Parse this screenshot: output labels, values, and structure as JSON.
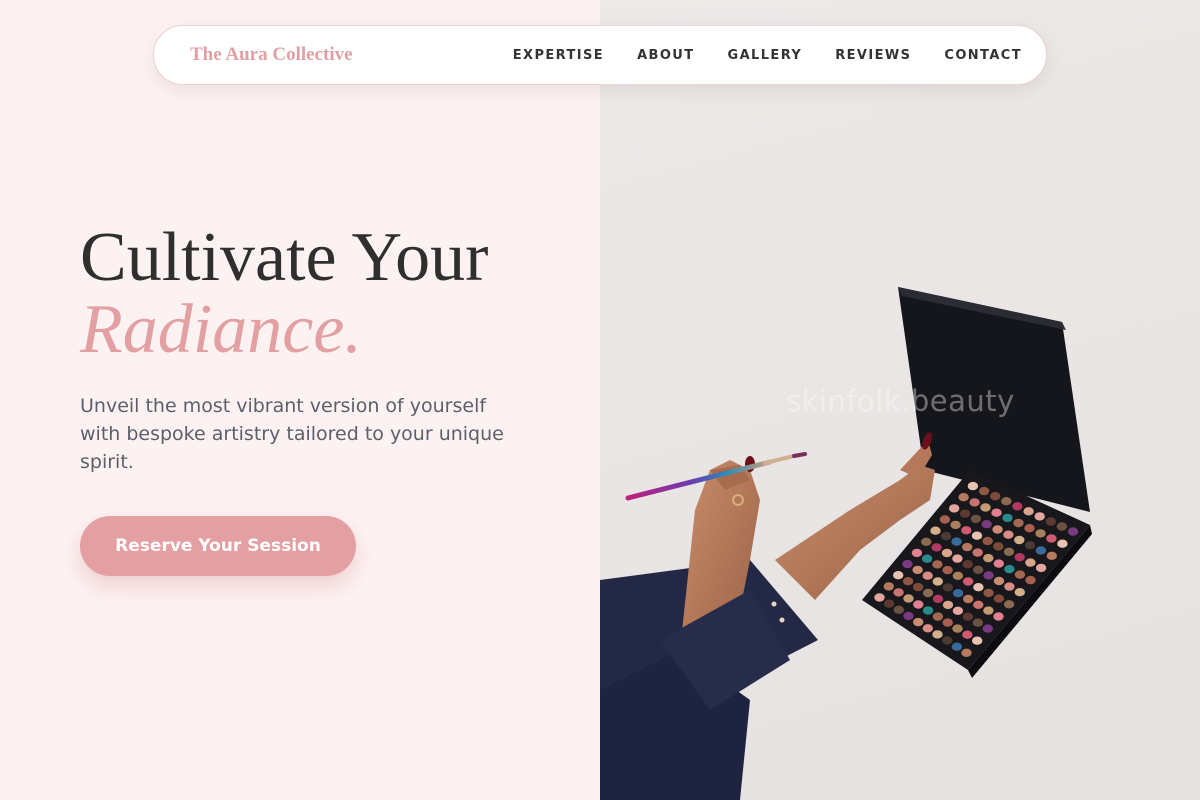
{
  "nav": {
    "brand": "The Aura Collective",
    "links": [
      "EXPERTISE",
      "ABOUT",
      "GALLERY",
      "REVIEWS",
      "CONTACT"
    ]
  },
  "hero": {
    "title_line1": "Cultivate Your",
    "title_line2": "Radiance.",
    "subtitle": "Unveil the most vibrant version of yourself with bespoke artistry tailored to your unique spirit.",
    "cta_label": "Reserve Your Session"
  },
  "photo": {
    "watermark": "skinfolk.beauty",
    "subject": "hand holding makeup brush and open eyeshadow palette"
  },
  "colors": {
    "accent_pink": "#e49fa2",
    "background_blush": "#fdf2f2",
    "heading_dark": "#2f2f2f",
    "body_text": "#5c5f6a"
  }
}
